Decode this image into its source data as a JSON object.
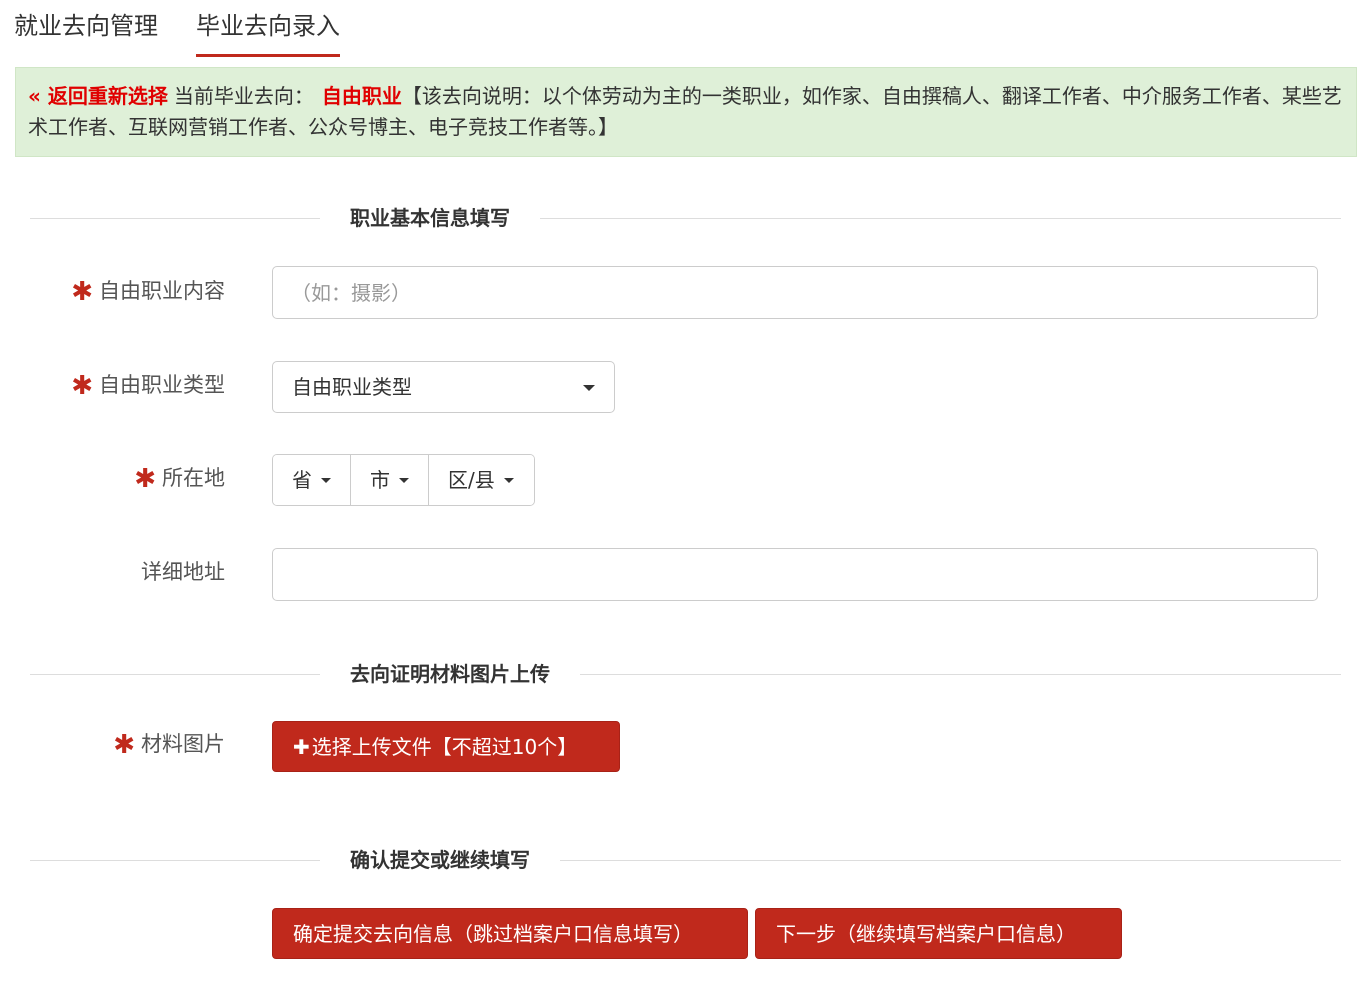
{
  "tabs": [
    {
      "label": "就业去向管理"
    },
    {
      "label": "毕业去向录入"
    }
  ],
  "notice": {
    "back_icon": "«",
    "back_label": "返回重新选择",
    "current_label": "当前毕业去向：",
    "current_value": "自由职业",
    "description": "【该去向说明：以个体劳动为主的一类职业，如作家、自由撰稿人、翻译工作者、中介服务工作者、某些艺术工作者、互联网营销工作者、公众号博主、电子竞技工作者等。】"
  },
  "sections": {
    "basic": "职业基本信息填写",
    "upload": "去向证明材料图片上传",
    "confirm": "确认提交或继续填写"
  },
  "form": {
    "required_mark": "✱",
    "content_label": "自由职业内容",
    "content_placeholder": "（如：摄影）",
    "type_label": "自由职业类型",
    "type_value": "自由职业类型",
    "location_label": "所在地",
    "province": "省",
    "city": "市",
    "district": "区/县",
    "address_label": "详细地址",
    "address_value": "",
    "material_label": "材料图片",
    "upload_button": "选择上传文件【不超过10个】"
  },
  "actions": {
    "submit": "确定提交去向信息（跳过档案户口信息填写）",
    "next": "下一步（继续填写档案户口信息）"
  },
  "colors": {
    "accent": "#c0291c",
    "notice_bg": "#dff0d8",
    "alert_red": "#e00000"
  },
  "icons": {
    "plus": "plus-icon",
    "caret": "caret-down-icon",
    "required": "asterisk-icon"
  }
}
